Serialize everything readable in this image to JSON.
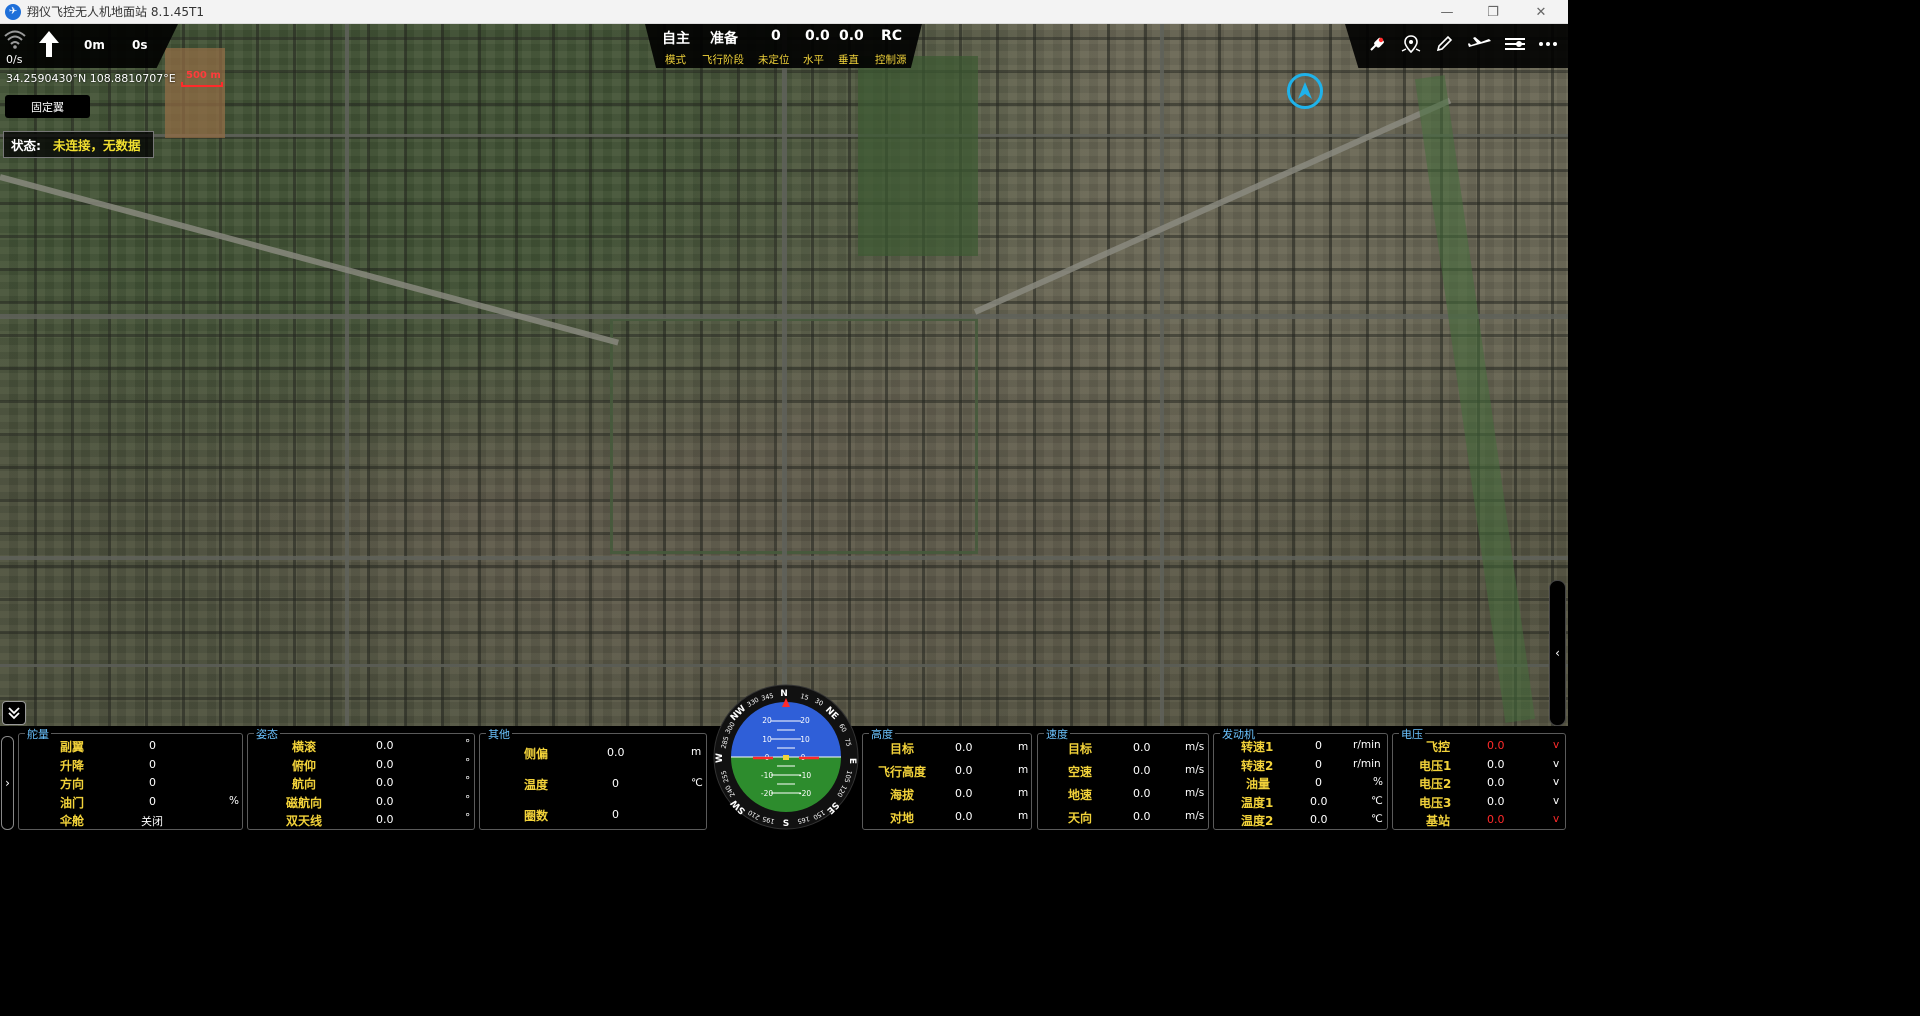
{
  "window": {
    "title": "翔仪飞控无人机地面站 8.1.45T1",
    "controls": [
      "—",
      "❐",
      "✕"
    ]
  },
  "top_left": {
    "signal": "0/s",
    "distance": "0m",
    "time": "0s"
  },
  "map": {
    "coords": "34.2590430°N 108.8810707°E",
    "scale": "500 m"
  },
  "vehicle_type": "固定翼",
  "status": {
    "label": "状态:",
    "value": "未连接，无数据"
  },
  "flight": {
    "values": [
      "自主",
      "准备",
      "0",
      "0.0",
      "0.0",
      "RC"
    ],
    "labels": [
      "模式",
      "飞行阶段",
      "未定位",
      "水平",
      "垂直",
      "控制源"
    ]
  },
  "toolbar": {
    "icons": [
      "plug-icon",
      "map-marker-icon",
      "pencil-icon",
      "airplane-icon",
      "settings-sliders-icon",
      "more-icon"
    ]
  },
  "panels": {
    "rudder": {
      "title": "舵量",
      "rows": [
        {
          "label": "副翼",
          "value": "0",
          "unit": ""
        },
        {
          "label": "升降",
          "value": "0",
          "unit": ""
        },
        {
          "label": "方向",
          "value": "0",
          "unit": ""
        },
        {
          "label": "油门",
          "value": "0",
          "unit": "%"
        },
        {
          "label": "伞舱",
          "value": "关闭",
          "unit": ""
        }
      ]
    },
    "attitude": {
      "title": "姿态",
      "rows": [
        {
          "label": "横滚",
          "value": "0.0",
          "unit": "°"
        },
        {
          "label": "俯仰",
          "value": "0.0",
          "unit": "°"
        },
        {
          "label": "航向",
          "value": "0.0",
          "unit": "°"
        },
        {
          "label": "磁航向",
          "value": "0.0",
          "unit": "°"
        },
        {
          "label": "双天线",
          "value": "0.0",
          "unit": "°"
        }
      ]
    },
    "other": {
      "title": "其他",
      "rows": [
        {
          "label": "侧偏",
          "value": "0.0",
          "unit": "m"
        },
        {
          "label": "温度",
          "value": "0",
          "unit": "℃"
        },
        {
          "label": "圈数",
          "value": "0",
          "unit": ""
        }
      ]
    },
    "altitude": {
      "title": "高度",
      "rows": [
        {
          "label": "目标",
          "value": "0.0",
          "unit": "m"
        },
        {
          "label": "飞行高度",
          "value": "0.0",
          "unit": "m"
        },
        {
          "label": "海拔",
          "value": "0.0",
          "unit": "m"
        },
        {
          "label": "对地",
          "value": "0.0",
          "unit": "m"
        }
      ]
    },
    "speed": {
      "title": "速度",
      "rows": [
        {
          "label": "目标",
          "value": "0.0",
          "unit": "m/s"
        },
        {
          "label": "空速",
          "value": "0.0",
          "unit": "m/s"
        },
        {
          "label": "地速",
          "value": "0.0",
          "unit": "m/s"
        },
        {
          "label": "天向",
          "value": "0.0",
          "unit": "m/s"
        }
      ]
    },
    "engine": {
      "title": "发动机",
      "rows": [
        {
          "label": "转速1",
          "value": "0",
          "unit": "r/min"
        },
        {
          "label": "转速2",
          "value": "0",
          "unit": "r/min"
        },
        {
          "label": "油量",
          "value": "0",
          "unit": "%"
        },
        {
          "label": "温度1",
          "value": "0.0",
          "unit": "℃"
        },
        {
          "label": "温度2",
          "value": "0.0",
          "unit": "℃"
        }
      ]
    },
    "voltage": {
      "title": "电压",
      "rows": [
        {
          "label": "飞控",
          "value": "0.0",
          "unit": "v",
          "alert": true
        },
        {
          "label": "电压1",
          "value": "0.0",
          "unit": "v"
        },
        {
          "label": "电压2",
          "value": "0.0",
          "unit": "v"
        },
        {
          "label": "电压3",
          "value": "0.0",
          "unit": "v"
        },
        {
          "label": "基站",
          "value": "0.0",
          "unit": "v",
          "alert": true
        }
      ]
    }
  },
  "compass": {
    "cardinals": [
      "N",
      "NE",
      "E",
      "SE",
      "S",
      "SW",
      "W",
      "NW"
    ],
    "degree_labels": [
      "15",
      "30",
      "60",
      "75",
      "105",
      "120",
      "150",
      "165",
      "195",
      "210",
      "240",
      "255",
      "285",
      "300",
      "330",
      "345"
    ],
    "pitch_labels": [
      "20",
      "10",
      "0",
      "-10",
      "-20"
    ],
    "sky_color": "#2f5fd8",
    "ground_color": "#2d8c2d"
  },
  "colors": {
    "accent_yellow": "#f2d23a",
    "panel_title_blue": "#6bc3ff",
    "alert_red": "#ff2a2a",
    "home_marker": "#1fb2ea"
  }
}
